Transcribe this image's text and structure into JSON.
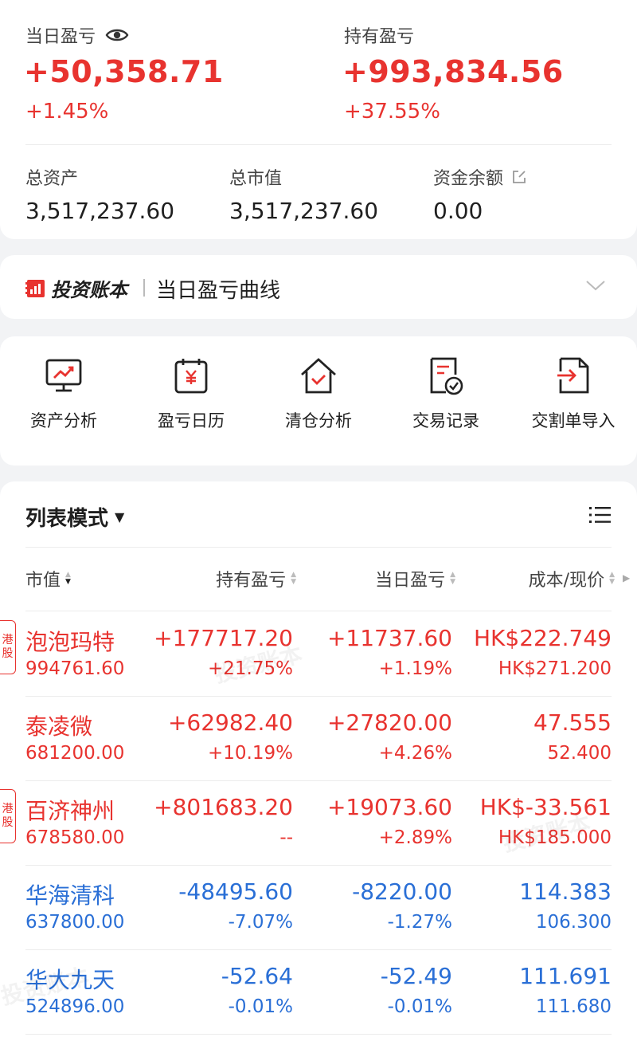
{
  "summary": {
    "daily_pnl_label": "当日盈亏",
    "daily_pnl_value": "+50,358.71",
    "daily_pnl_pct": "+1.45%",
    "holding_pnl_label": "持有盈亏",
    "holding_pnl_value": "+993,834.56",
    "holding_pnl_pct": "+37.55%",
    "total_assets_label": "总资产",
    "total_assets_value": "3,517,237.60",
    "total_market_value_label": "总市值",
    "total_market_value_value": "3,517,237.60",
    "cash_balance_label": "资金余额",
    "cash_balance_value": "0.00"
  },
  "curve": {
    "logo_text": "投资账本",
    "title": "当日盈亏曲线"
  },
  "tools": [
    {
      "label": "资产分析",
      "icon": "monitor-chart-icon"
    },
    {
      "label": "盈亏日历",
      "icon": "calendar-yen-icon"
    },
    {
      "label": "清仓分析",
      "icon": "house-check-icon"
    },
    {
      "label": "交易记录",
      "icon": "document-check-icon"
    },
    {
      "label": "交割单导入",
      "icon": "file-import-icon"
    }
  ],
  "list": {
    "mode_label": "列表模式",
    "columns": {
      "market_value": "市值",
      "holding_pnl": "持有盈亏",
      "daily_pnl": "当日盈亏",
      "cost_price": "成本/现价"
    },
    "hk_tag": "港股",
    "rows": [
      {
        "name": "泡泡玛特",
        "market_value": "994761.60",
        "holding_pnl": "+177717.20",
        "holding_pct": "+21.75%",
        "daily_pnl": "+11737.60",
        "daily_pct": "+1.19%",
        "cost": "HK$222.749",
        "price": "HK$271.200"
      },
      {
        "name": "泰凌微",
        "market_value": "681200.00",
        "holding_pnl": "+62982.40",
        "holding_pct": "+10.19%",
        "daily_pnl": "+27820.00",
        "daily_pct": "+4.26%",
        "cost": "47.555",
        "price": "52.400"
      },
      {
        "name": "百济神州",
        "market_value": "678580.00",
        "holding_pnl": "+801683.20",
        "holding_pct": "--",
        "daily_pnl": "+19073.60",
        "daily_pct": "+2.89%",
        "cost": "HK$-33.561",
        "price": "HK$185.000"
      },
      {
        "name": "华海清科",
        "market_value": "637800.00",
        "holding_pnl": "-48495.60",
        "holding_pct": "-7.07%",
        "daily_pnl": "-8220.00",
        "daily_pct": "-1.27%",
        "cost": "114.383",
        "price": "106.300"
      },
      {
        "name": "华大九天",
        "market_value": "524896.00",
        "holding_pnl": "-52.64",
        "holding_pct": "-0.01%",
        "daily_pnl": "-52.49",
        "daily_pct": "-0.01%",
        "cost": "111.691",
        "price": "111.680"
      }
    ]
  },
  "colors": {
    "up": "#e8332f",
    "down": "#2a6fd6",
    "accent": "#e8332f"
  },
  "watermark": "投资账本"
}
